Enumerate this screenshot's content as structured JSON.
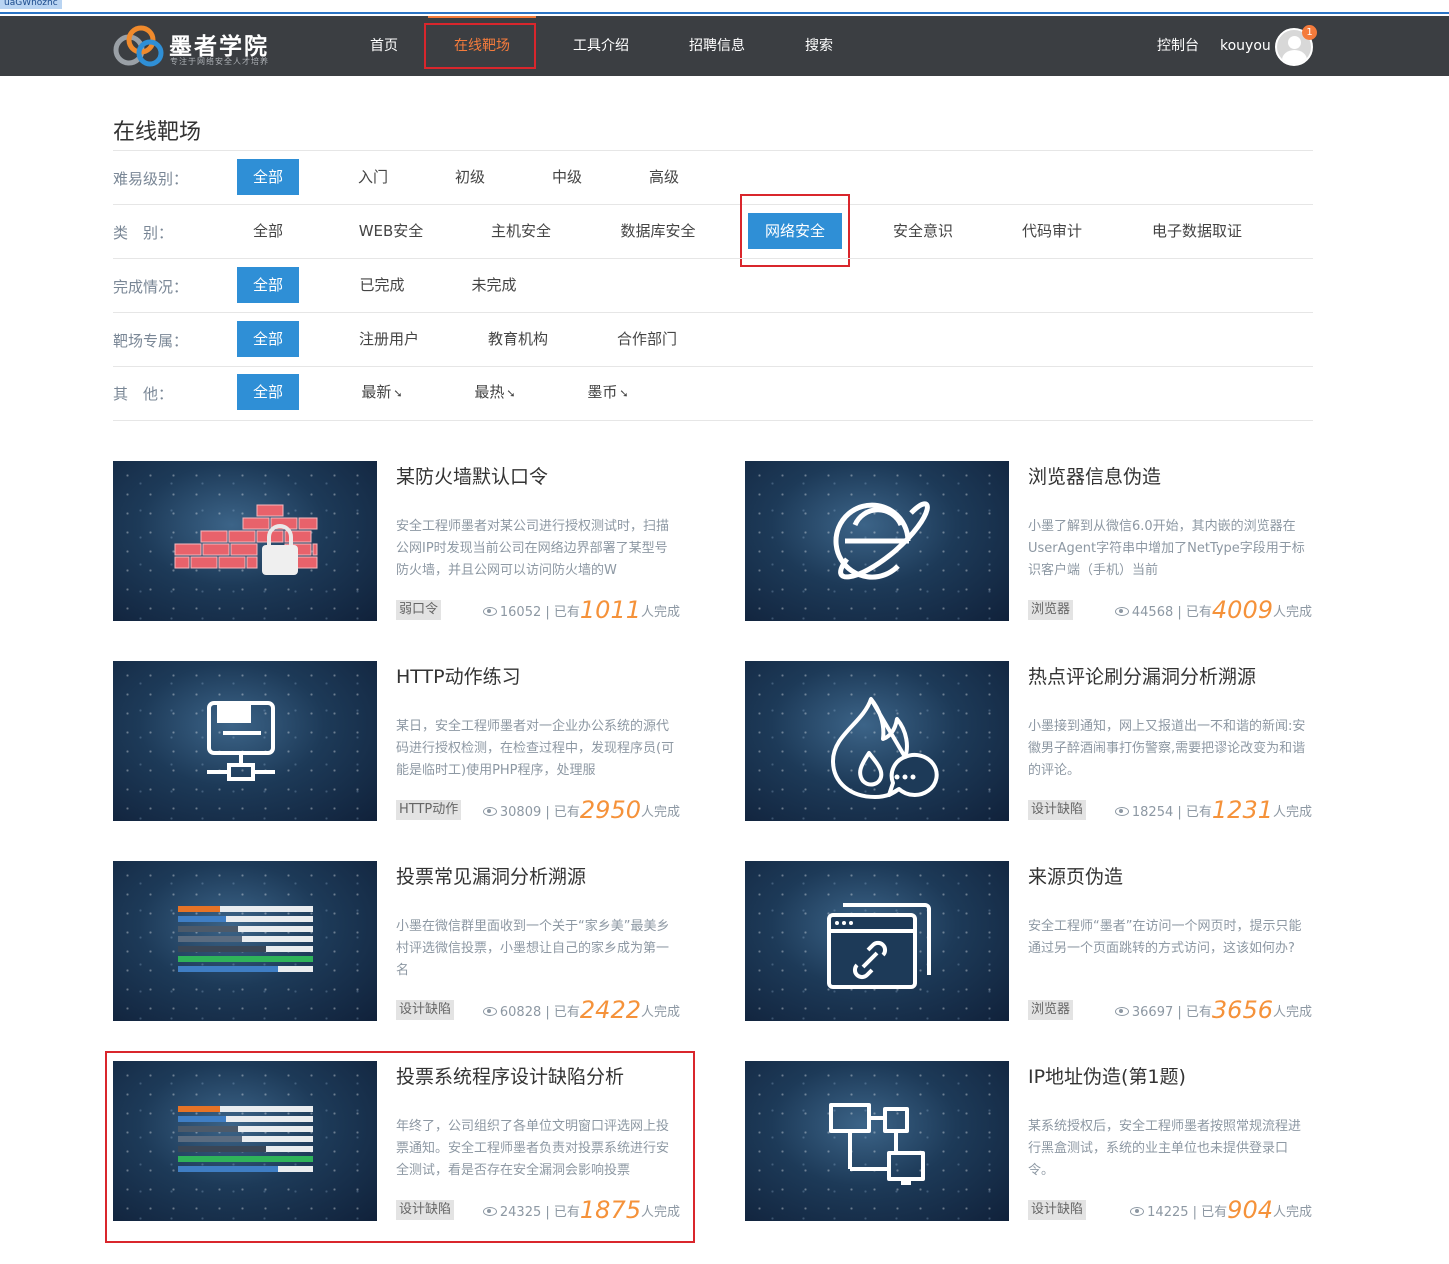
{
  "top_selection_text": "uaGWnozhc",
  "nav": {
    "logo_name": "墨者学院",
    "logo_slogan": "专注于网络安全人才培养",
    "items": [
      "首页",
      "在线靶场",
      "工具介绍",
      "招聘信息",
      "搜索"
    ],
    "active": "在线靶场",
    "console": "控制台",
    "username": "kouyou",
    "badge": "1"
  },
  "page_title": "在线靶场",
  "filters": {
    "difficulty": {
      "label": "难易级别：",
      "options": [
        "全部",
        "入门",
        "初级",
        "中级",
        "高级"
      ],
      "selected": "全部"
    },
    "category": {
      "label": "类　别：",
      "options": [
        "全部",
        "WEB安全",
        "主机安全",
        "数据库安全",
        "网络安全",
        "安全意识",
        "代码审计",
        "电子数据取证"
      ],
      "selected": "网络安全"
    },
    "completion": {
      "label": "完成情况：",
      "options": [
        "全部",
        "已完成",
        "未完成"
      ],
      "selected": "全部"
    },
    "owner": {
      "label": "靶场专属：",
      "options": [
        "全部",
        "注册用户",
        "教育机构",
        "合作部门"
      ],
      "selected": "全部"
    },
    "other": {
      "label": "其　他：",
      "options": [
        "全部",
        "最新",
        "最热",
        "墨币"
      ],
      "selected": "全部",
      "sort_icon": "sort-arrow-icon"
    }
  },
  "stats_labels": {
    "have": "| 已有",
    "done": "人完成"
  },
  "cards": [
    {
      "title": "某防火墙默认口令",
      "desc": "安全工程师墨者对某公司进行授权测试时，扫描公网IP时发现当前公司在网络边界部署了某型号防火墙，并且公网可以访问防火墙的W",
      "tag": "弱口令",
      "views": "16052",
      "completed": "1011",
      "icon": "firewall-lock-icon"
    },
    {
      "title": "浏览器信息伪造",
      "desc": "小墨了解到从微信6.0开始，其内嵌的浏览器在UserAgent字符串中增加了NetType字段用于标识客户端（手机）当前",
      "tag": "浏览器",
      "views": "44568",
      "completed": "4009",
      "icon": "ie-browser-icon"
    },
    {
      "title": "HTTP动作练习",
      "desc": "某日，安全工程师墨者对一企业办公系统的源代码进行授权检测，在检查过程中，发现程序员(可能是临时工)使用PHP程序，处理服",
      "tag": "HTTP动作",
      "views": "30809",
      "completed": "2950",
      "icon": "network-computer-icon"
    },
    {
      "title": "热点评论刷分漏洞分析溯源",
      "desc": "小墨接到通知，网上又报道出一不和谐的新闻:安徽男子醉酒闹事打伤警察,需要把谬论改变为和谐的评论。",
      "tag": "设计缺陷",
      "views": "18254",
      "completed": "1231",
      "icon": "hot-comment-icon"
    },
    {
      "title": "投票常见漏洞分析溯源",
      "desc": "小墨在微信群里面收到一个关于“家乡美”最美乡村评选微信投票，小墨想让自己的家乡成为第一名",
      "tag": "设计缺陷",
      "views": "60828",
      "completed": "2422",
      "icon": "vote-bars-icon"
    },
    {
      "title": "来源页伪造",
      "desc": "安全工程师“墨者”在访问一个网页时，提示只能通过另一个页面跳转的方式访问，这该如何办?",
      "tag": "浏览器",
      "views": "36697",
      "completed": "3656",
      "icon": "browser-link-icon"
    },
    {
      "title": "投票系统程序设计缺陷分析",
      "desc": "年终了，公司组织了各单位文明窗口评选网上投票通知。安全工程师墨者负责对投票系统进行安全测试，看是否存在安全漏洞会影响投票",
      "tag": "设计缺陷",
      "views": "24325",
      "completed": "1875",
      "icon": "vote-bars-icon"
    },
    {
      "title": "IP地址伪造(第1题)",
      "desc": "某系统授权后，安全工程师墨者按照常规流程进行黑盒测试，系统的业主单位也未提供登录口令。",
      "tag": "设计缺陷",
      "views": "14225",
      "completed": "904",
      "icon": "ip-network-icon"
    }
  ]
}
